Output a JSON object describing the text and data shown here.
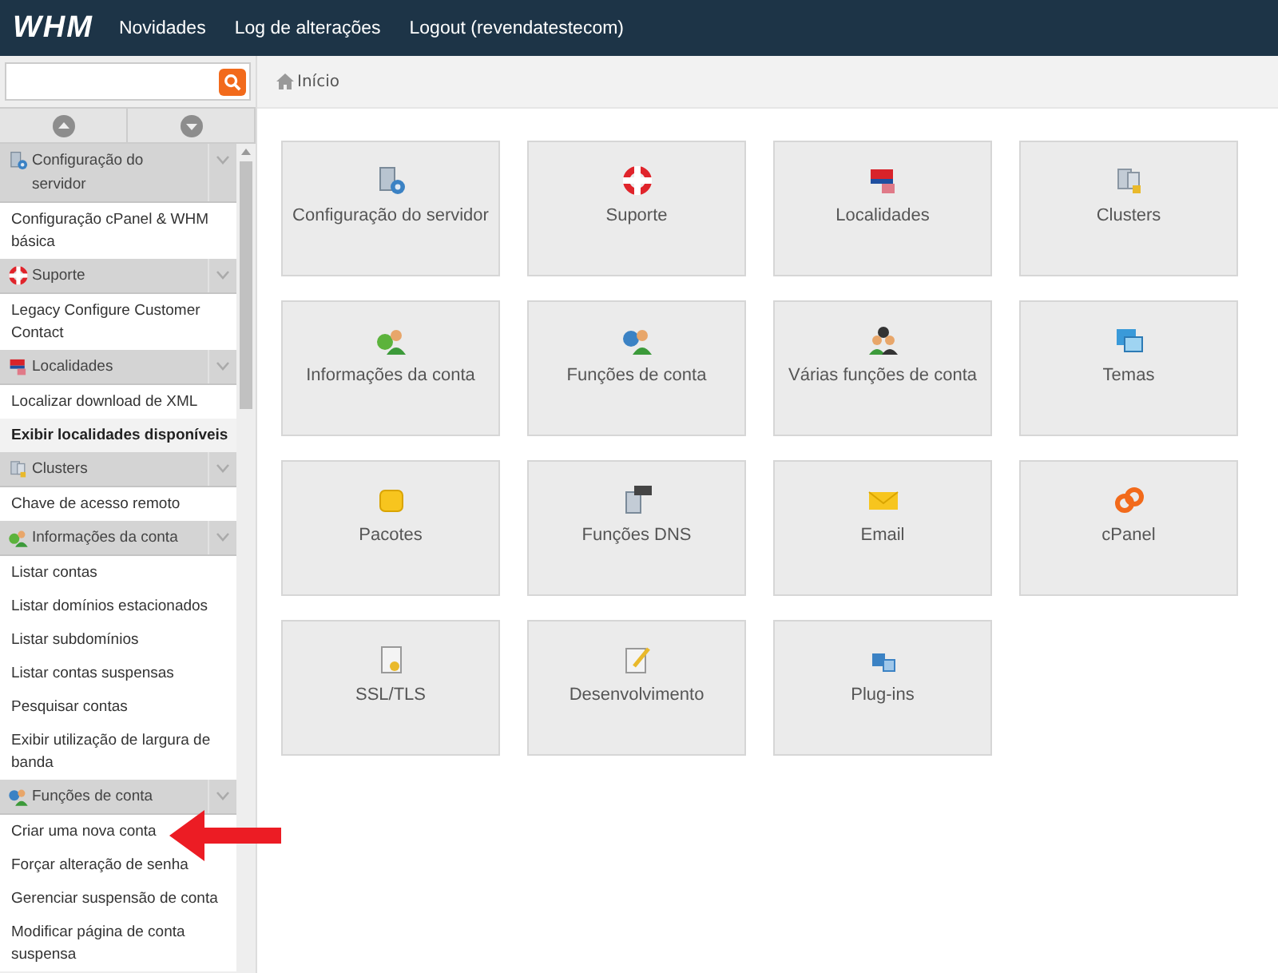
{
  "top_bar": {
    "logo": "WHM",
    "links": [
      "Novidades",
      "Log de alterações",
      "Logout (revendatestecom)"
    ]
  },
  "breadcrumb": "Início",
  "sidebar": {
    "sections": [
      {
        "title": "Configuração do servidor",
        "expanded": true,
        "items": [
          {
            "label": "Configuração cPanel & WHM básica",
            "selected": false
          }
        ]
      },
      {
        "title": "Suporte",
        "expanded": true,
        "items": [
          {
            "label": "Legacy Configure Customer Contact",
            "selected": false
          }
        ]
      },
      {
        "title": "Localidades",
        "expanded": true,
        "items": [
          {
            "label": "Localizar download de XML",
            "selected": false
          },
          {
            "label": "Exibir localidades disponíveis",
            "selected": true
          }
        ]
      },
      {
        "title": "Clusters",
        "expanded": true,
        "items": [
          {
            "label": "Chave de acesso remoto",
            "selected": false
          }
        ]
      },
      {
        "title": "Informações da conta",
        "expanded": true,
        "items": [
          {
            "label": "Listar contas",
            "selected": false
          },
          {
            "label": "Listar domínios estacionados",
            "selected": false
          },
          {
            "label": "Listar subdomínios",
            "selected": false
          },
          {
            "label": "Listar contas suspensas",
            "selected": false
          },
          {
            "label": "Pesquisar contas",
            "selected": false
          },
          {
            "label": "Exibir utilização de largura de banda",
            "selected": false
          }
        ]
      },
      {
        "title": "Funções de conta",
        "expanded": true,
        "items": [
          {
            "label": "Criar uma nova conta",
            "selected": false
          },
          {
            "label": "Forçar alteração de senha",
            "selected": false
          },
          {
            "label": "Gerenciar suspensão de conta",
            "selected": false
          },
          {
            "label": "Modificar página de conta suspensa",
            "selected": false
          }
        ]
      }
    ]
  },
  "tiles": [
    "Configuração do servidor",
    "Suporte",
    "Localidades",
    "Clusters",
    "Informações da conta",
    "Funções de conta",
    "Várias funções de conta",
    "Temas",
    "Pacotes",
    "Funções DNS",
    "Email",
    "cPanel",
    "SSL/TLS",
    "Desenvolvimento",
    "Plug-ins"
  ]
}
